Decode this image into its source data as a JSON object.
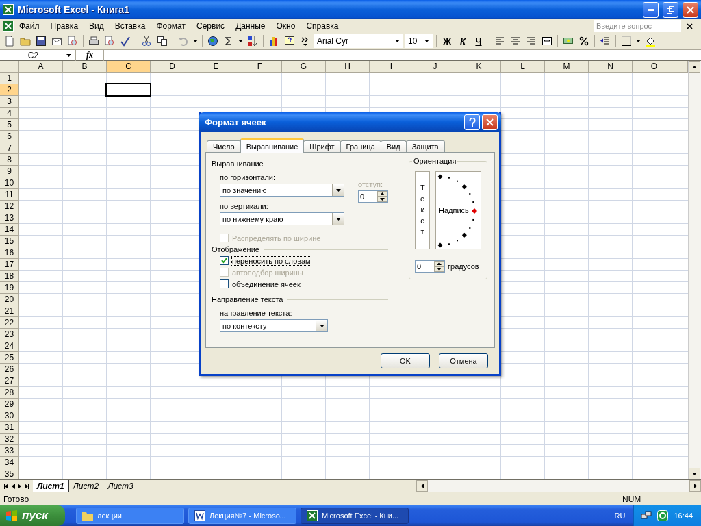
{
  "window": {
    "title": "Microsoft Excel - Книга1"
  },
  "menu": [
    "Файл",
    "Правка",
    "Вид",
    "Вставка",
    "Формат",
    "Сервис",
    "Данные",
    "Окно",
    "Справка"
  ],
  "help_search": {
    "placeholder": "Введите вопрос"
  },
  "formatting": {
    "font": "Arial Cyr",
    "size": "10",
    "bold": "Ж",
    "italic": "К",
    "underline": "Ч"
  },
  "formula_bar": {
    "name_box": "C2",
    "fx": "fx"
  },
  "sheet": {
    "columns": [
      {
        "label": "A",
        "selected": false
      },
      {
        "label": "B",
        "selected": false
      },
      {
        "label": "C",
        "selected": true
      },
      {
        "label": "D",
        "selected": false
      },
      {
        "label": "E",
        "selected": false
      },
      {
        "label": "F",
        "selected": false
      },
      {
        "label": "G",
        "selected": false
      },
      {
        "label": "H",
        "selected": false
      },
      {
        "label": "I",
        "selected": false
      },
      {
        "label": "J",
        "selected": false
      },
      {
        "label": "K",
        "selected": false
      },
      {
        "label": "L",
        "selected": false
      },
      {
        "label": "M",
        "selected": false
      },
      {
        "label": "N",
        "selected": false
      },
      {
        "label": "O",
        "selected": false
      }
    ],
    "rows": [
      {
        "label": "1",
        "selected": false
      },
      {
        "label": "2",
        "selected": true
      },
      {
        "label": "3",
        "selected": false
      },
      {
        "label": "4",
        "selected": false
      },
      {
        "label": "5",
        "selected": false
      },
      {
        "label": "6",
        "selected": false
      },
      {
        "label": "7",
        "selected": false
      },
      {
        "label": "8",
        "selected": false
      },
      {
        "label": "9",
        "selected": false
      },
      {
        "label": "10",
        "selected": false
      },
      {
        "label": "11",
        "selected": false
      },
      {
        "label": "12",
        "selected": false
      },
      {
        "label": "13",
        "selected": false
      },
      {
        "label": "14",
        "selected": false
      },
      {
        "label": "15",
        "selected": false
      },
      {
        "label": "16",
        "selected": false
      },
      {
        "label": "17",
        "selected": false
      },
      {
        "label": "18",
        "selected": false
      },
      {
        "label": "19",
        "selected": false
      },
      {
        "label": "20",
        "selected": false
      },
      {
        "label": "21",
        "selected": false
      },
      {
        "label": "22",
        "selected": false
      },
      {
        "label": "23",
        "selected": false
      },
      {
        "label": "24",
        "selected": false
      },
      {
        "label": "25",
        "selected": false
      },
      {
        "label": "26",
        "selected": false
      },
      {
        "label": "27",
        "selected": false
      },
      {
        "label": "28",
        "selected": false
      },
      {
        "label": "29",
        "selected": false
      },
      {
        "label": "30",
        "selected": false
      },
      {
        "label": "31",
        "selected": false
      },
      {
        "label": "32",
        "selected": false
      },
      {
        "label": "33",
        "selected": false
      },
      {
        "label": "34",
        "selected": false
      },
      {
        "label": "35",
        "selected": false
      }
    ]
  },
  "sheet_tabs": [
    {
      "label": "Лист1",
      "selected": true
    },
    {
      "label": "Лист2",
      "selected": false
    },
    {
      "label": "Лист3",
      "selected": false
    }
  ],
  "status_bar": {
    "text": "Готово",
    "indicator": "NUM"
  },
  "dialog": {
    "title": "Формат ячеек",
    "tabs": [
      {
        "label": "Число",
        "selected": false
      },
      {
        "label": "Выравнивание",
        "selected": true
      },
      {
        "label": "Шрифт",
        "selected": false
      },
      {
        "label": "Граница",
        "selected": false
      },
      {
        "label": "Вид",
        "selected": false
      },
      {
        "label": "Защита",
        "selected": false
      }
    ],
    "alignment_section": "Выравнивание",
    "horizontal_label": "по горизонтали:",
    "horizontal_value": "по значению",
    "indent_label": "отступ:",
    "indent_value": "0",
    "vertical_label": "по вертикали:",
    "vertical_value": "по нижнему краю",
    "distribute": {
      "label": "Распределять по ширине",
      "checked": false,
      "disabled": true
    },
    "display_section": "Отображение",
    "display_options": [
      {
        "label": "переносить по словам",
        "checked": true,
        "disabled": false
      },
      {
        "label": "автоподбор ширины",
        "checked": false,
        "disabled": true
      },
      {
        "label": "объединение ячеек",
        "checked": false,
        "disabled": false
      }
    ],
    "direction_section": "Направление текста",
    "direction_label": "направление текста:",
    "direction_value": "по контексту",
    "orientation": {
      "title": "Ориентация",
      "vertical_text": "Текст",
      "label": "Надпись",
      "degrees_value": "0",
      "degrees_label": "градусов"
    },
    "buttons": [
      "OK",
      "Отмена"
    ]
  },
  "taskbar": {
    "start": "пуск",
    "items": [
      {
        "label": "лекции",
        "kind": "folder",
        "selected": false
      },
      {
        "label": "Лекция№7 - Microso...",
        "kind": "word",
        "selected": false
      },
      {
        "label": "Microsoft Excel - Кни...",
        "kind": "excel",
        "selected": true
      }
    ],
    "language": "RU",
    "time": "16:44"
  }
}
